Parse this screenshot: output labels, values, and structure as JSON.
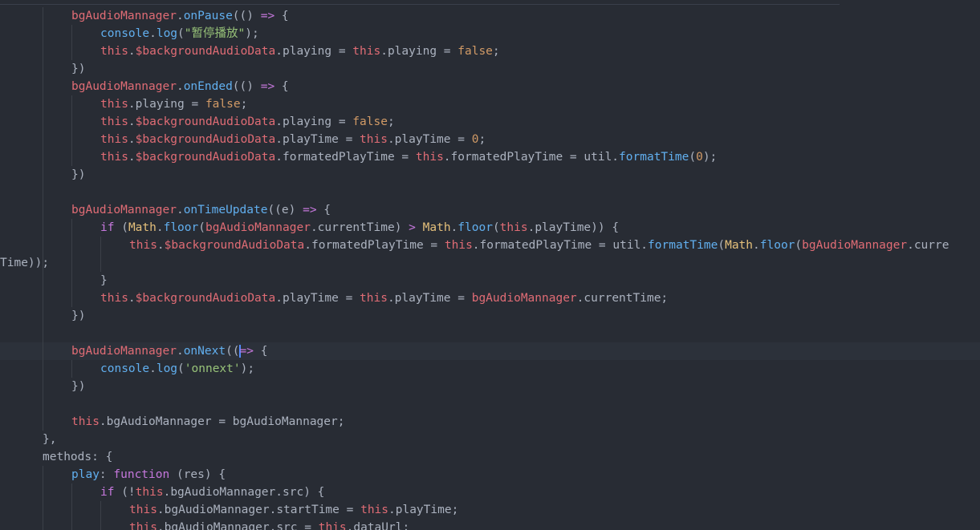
{
  "editor": {
    "lines": [
      {
        "indent": 2,
        "tokens": [
          [
            "vr",
            "bgAudioMannager"
          ],
          [
            "",
            "."
          ],
          [
            "fn",
            "onPause"
          ],
          [
            "",
            "(() "
          ],
          [
            "op",
            "=>"
          ],
          [
            "",
            " {"
          ]
        ]
      },
      {
        "indent": 3,
        "tokens": [
          [
            "fn",
            "console"
          ],
          [
            "",
            "."
          ],
          [
            "fn",
            "log"
          ],
          [
            "",
            "("
          ],
          [
            "st",
            "\"暂停播放\""
          ],
          [
            "",
            ");"
          ]
        ]
      },
      {
        "indent": 3,
        "tokens": [
          [
            "th",
            "this"
          ],
          [
            "",
            "."
          ],
          [
            "th",
            "$backgroundAudioData"
          ],
          [
            "",
            ".playing = "
          ],
          [
            "th",
            "this"
          ],
          [
            "",
            ".playing = "
          ],
          [
            "nm",
            "false"
          ],
          [
            "",
            ";"
          ]
        ]
      },
      {
        "indent": 2,
        "tokens": [
          [
            "",
            "})"
          ]
        ]
      },
      {
        "indent": 2,
        "tokens": [
          [
            "vr",
            "bgAudioMannager"
          ],
          [
            "",
            "."
          ],
          [
            "fn",
            "onEnded"
          ],
          [
            "",
            "(() "
          ],
          [
            "op",
            "=>"
          ],
          [
            "",
            " {"
          ]
        ]
      },
      {
        "indent": 3,
        "tokens": [
          [
            "th",
            "this"
          ],
          [
            "",
            ".playing = "
          ],
          [
            "nm",
            "false"
          ],
          [
            "",
            ";"
          ]
        ]
      },
      {
        "indent": 3,
        "tokens": [
          [
            "th",
            "this"
          ],
          [
            "",
            "."
          ],
          [
            "th",
            "$backgroundAudioData"
          ],
          [
            "",
            ".playing = "
          ],
          [
            "nm",
            "false"
          ],
          [
            "",
            ";"
          ]
        ]
      },
      {
        "indent": 3,
        "tokens": [
          [
            "th",
            "this"
          ],
          [
            "",
            "."
          ],
          [
            "th",
            "$backgroundAudioData"
          ],
          [
            "",
            ".playTime = "
          ],
          [
            "th",
            "this"
          ],
          [
            "",
            ".playTime = "
          ],
          [
            "nm",
            "0"
          ],
          [
            "",
            ";"
          ]
        ]
      },
      {
        "indent": 3,
        "tokens": [
          [
            "th",
            "this"
          ],
          [
            "",
            "."
          ],
          [
            "th",
            "$backgroundAudioData"
          ],
          [
            "",
            ".formatedPlayTime = "
          ],
          [
            "th",
            "this"
          ],
          [
            "",
            ".formatedPlayTime = util."
          ],
          [
            "fn",
            "formatTime"
          ],
          [
            "",
            "("
          ],
          [
            "nm",
            "0"
          ],
          [
            "",
            ");"
          ]
        ]
      },
      {
        "indent": 2,
        "tokens": [
          [
            "",
            "})"
          ]
        ]
      },
      {
        "indent": 0,
        "tokens": []
      },
      {
        "indent": 2,
        "tokens": [
          [
            "vr",
            "bgAudioMannager"
          ],
          [
            "",
            "."
          ],
          [
            "fn",
            "onTimeUpdate"
          ],
          [
            "",
            "((e) "
          ],
          [
            "op",
            "=>"
          ],
          [
            "",
            " {"
          ]
        ]
      },
      {
        "indent": 3,
        "tokens": [
          [
            "kw",
            "if"
          ],
          [
            "",
            " ("
          ],
          [
            "cls",
            "Math"
          ],
          [
            "",
            "."
          ],
          [
            "fn",
            "floor"
          ],
          [
            "",
            "("
          ],
          [
            "vr",
            "bgAudioMannager"
          ],
          [
            "",
            ".currentTime) "
          ],
          [
            "op",
            ">"
          ],
          [
            "",
            " "
          ],
          [
            "cls",
            "Math"
          ],
          [
            "",
            "."
          ],
          [
            "fn",
            "floor"
          ],
          [
            "",
            "("
          ],
          [
            "th",
            "this"
          ],
          [
            "",
            ".playTime)) {"
          ]
        ]
      },
      {
        "indent": 4,
        "tokens": [
          [
            "th",
            "this"
          ],
          [
            "",
            "."
          ],
          [
            "th",
            "$backgroundAudioData"
          ],
          [
            "",
            ".formatedPlayTime = "
          ],
          [
            "th",
            "this"
          ],
          [
            "",
            ".formatedPlayTime = util."
          ],
          [
            "fn",
            "formatTime"
          ],
          [
            "",
            "("
          ],
          [
            "cls",
            "Math"
          ],
          [
            "",
            "."
          ],
          [
            "fn",
            "floor"
          ],
          [
            "",
            "("
          ],
          [
            "vr",
            "bgAudioMannager"
          ],
          [
            "",
            ".curre"
          ]
        ]
      },
      {
        "indent": 0,
        "wrap": true,
        "tokens": [
          [
            "",
            "Time));"
          ]
        ]
      },
      {
        "indent": 3,
        "tokens": [
          [
            "",
            "}"
          ]
        ]
      },
      {
        "indent": 3,
        "tokens": [
          [
            "th",
            "this"
          ],
          [
            "",
            "."
          ],
          [
            "th",
            "$backgroundAudioData"
          ],
          [
            "",
            ".playTime = "
          ],
          [
            "th",
            "this"
          ],
          [
            "",
            ".playTime = "
          ],
          [
            "vr",
            "bgAudioMannager"
          ],
          [
            "",
            ".currentTime;"
          ]
        ]
      },
      {
        "indent": 2,
        "tokens": [
          [
            "",
            "})"
          ]
        ]
      },
      {
        "indent": 0,
        "tokens": []
      },
      {
        "indent": 2,
        "current": true,
        "tokens": [
          [
            "vr",
            "bgAudioMannager"
          ],
          [
            "",
            "."
          ],
          [
            "fn",
            "onNext"
          ],
          [
            "",
            "(("
          ],
          [
            "cursor",
            ""
          ],
          [
            ") "
          ],
          [
            "op",
            "=>"
          ],
          [
            "",
            " {"
          ]
        ]
      },
      {
        "indent": 3,
        "tokens": [
          [
            "fn",
            "console"
          ],
          [
            "",
            "."
          ],
          [
            "fn",
            "log"
          ],
          [
            "",
            "("
          ],
          [
            "st",
            "'onnext'"
          ],
          [
            "",
            ");"
          ]
        ]
      },
      {
        "indent": 2,
        "tokens": [
          [
            "",
            "})"
          ]
        ]
      },
      {
        "indent": 0,
        "tokens": []
      },
      {
        "indent": 2,
        "tokens": [
          [
            "th",
            "this"
          ],
          [
            "",
            ".bgAudioMannager = bgAudioMannager;"
          ]
        ]
      },
      {
        "indent": 1,
        "tokens": [
          [
            "",
            "},"
          ]
        ]
      },
      {
        "indent": 1,
        "tokens": [
          [
            "",
            "methods: {"
          ]
        ]
      },
      {
        "indent": 2,
        "tokens": [
          [
            "fn",
            "play"
          ],
          [
            "",
            ": "
          ],
          [
            "kw",
            "function"
          ],
          [
            "",
            " (res) {"
          ]
        ]
      },
      {
        "indent": 3,
        "tokens": [
          [
            "kw",
            "if"
          ],
          [
            "",
            " (!"
          ],
          [
            "th",
            "this"
          ],
          [
            "",
            ".bgAudioMannager.src) {"
          ]
        ]
      },
      {
        "indent": 4,
        "tokens": [
          [
            "th",
            "this"
          ],
          [
            "",
            ".bgAudioMannager.startTime = "
          ],
          [
            "th",
            "this"
          ],
          [
            "",
            ".playTime;"
          ]
        ]
      },
      {
        "indent": 4,
        "tokens": [
          [
            "th",
            "this"
          ],
          [
            "",
            ".bgAudioMannager.src = "
          ],
          [
            "th",
            "this"
          ],
          [
            "",
            ".dataUrl;"
          ]
        ]
      }
    ]
  }
}
